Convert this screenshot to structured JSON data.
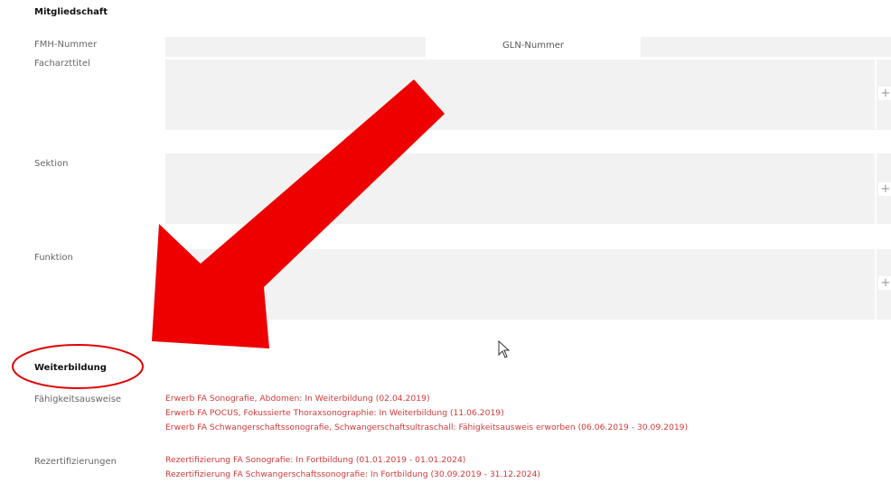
{
  "membership": {
    "title": "Mitgliedschaft",
    "fmh_label": "FMH-Nummer",
    "gln_label": "GLN-Nummer",
    "facharzttitel_label": "Facharzttitel",
    "sektion_label": "Sektion",
    "funktion_label": "Funktion",
    "add_symbol": "+"
  },
  "training": {
    "title": "Weiterbildung",
    "capabilities_label": "Fähigkeitsausweise",
    "capabilities": [
      "Erwerb FA Sonografie, Abdomen: In Weiterbildung (02.04.2019)",
      "Erwerb FA POCUS, Fokussierte Thoraxsonographie: In Weiterbildung (11.06.2019)",
      "Erwerb FA Schwangerschaftssonografie, Schwangerschaftsultraschall: Fähigkeitsausweis erworben (06.06.2019 - 30.09.2019)"
    ],
    "recert_label": "Rezertifizierungen",
    "recertifications": [
      "Rezertifizierung FA Sonografie: In Fortbildung (01.01.2019 - 01.01.2024)",
      "Rezertifizierung FA Schwangerschaftssonografie: In Fortbildung (30.09.2019 - 31.12.2024)"
    ]
  },
  "annotation": {
    "arrow_color": "#ee0000",
    "circle_color": "#e00000"
  }
}
